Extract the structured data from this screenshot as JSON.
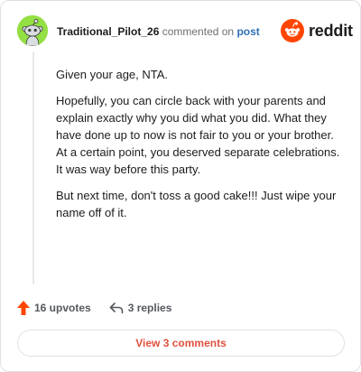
{
  "comment": {
    "username": "Traditional_Pilot_26",
    "action_text": "commented on",
    "post_link": "post",
    "paragraphs": [
      "Given your age, NTA.",
      "Hopefully, you can circle back with your parents and explain exactly why you did what you did. What they have done up to now is not fair to you or your brother. At a certain point, you deserved separate celebrations. It was way before this party.",
      "But next time, don't toss a good cake!!! Just wipe your name off of it."
    ],
    "upvotes_label": "16 upvotes",
    "replies_label": "3 replies",
    "view_comments_label": "View 3 comments"
  },
  "brand": {
    "name": "reddit",
    "logo_color": "#ff4500"
  },
  "colors": {
    "avatar_bg": "#94e044",
    "upvote": "#ff4500",
    "link": "#2f6fb5",
    "view_button_text": "#e0513f"
  },
  "icons": {
    "avatar": "snoo-avatar-icon",
    "logo": "reddit-logo-icon",
    "upvote": "upvote-arrow-icon",
    "reply": "reply-arrow-icon"
  }
}
